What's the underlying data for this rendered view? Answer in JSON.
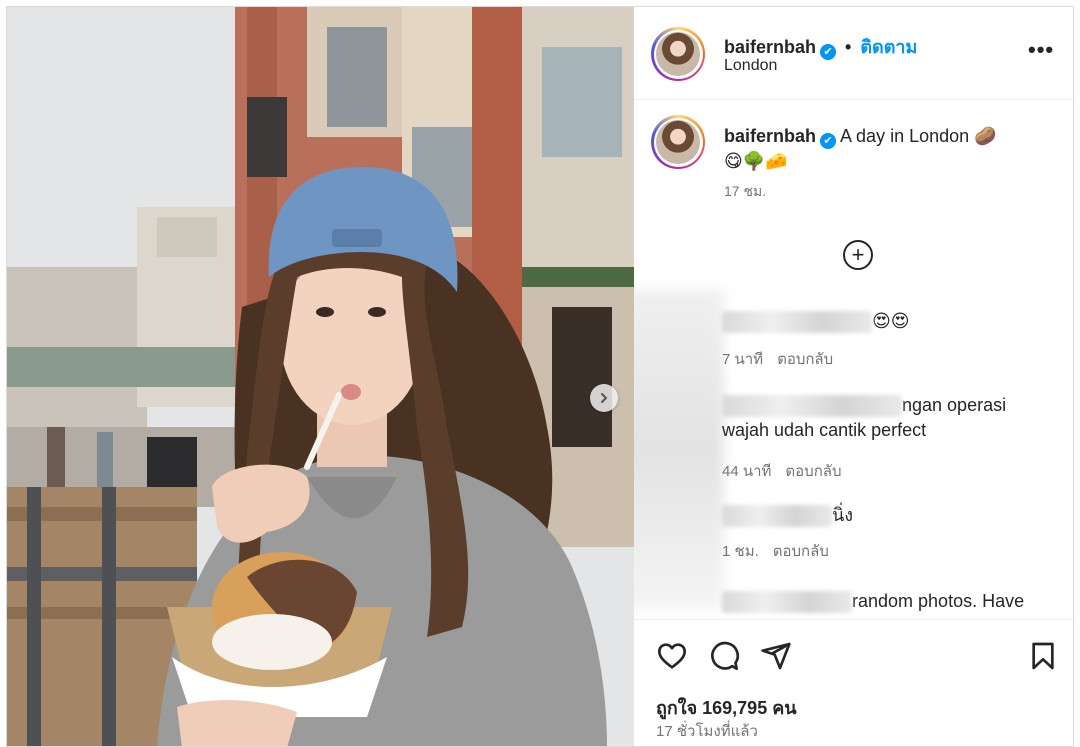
{
  "post": {
    "username": "baifernbah",
    "verified_mark": "✔",
    "separator": "•",
    "follow_label": "ติดตาม",
    "location": "London",
    "more_label": "•••"
  },
  "caption": {
    "username": "baifernbah",
    "text": "A day in London 🥔",
    "emoji_line": "😋🌳🧀",
    "time": "17 ชม."
  },
  "load_more_label": "+",
  "comments": [
    {
      "text_suffix": "😍😍",
      "time": "7 นาที",
      "reply": "ตอบกลับ"
    },
    {
      "text_suffix": "ngan operasi",
      "text_line2": "wajah udah cantik perfect",
      "time": "44 นาที",
      "reply": "ตอบกลับ"
    },
    {
      "text_suffix": "นิ่ง",
      "time": "1 ชม.",
      "reply": "ตอบกลับ"
    },
    {
      "text_suffix": "random photos. Have"
    }
  ],
  "actions": {
    "like_icon": "heart-icon",
    "comment_icon": "comment-icon",
    "share_icon": "share-icon",
    "save_icon": "bookmark-icon"
  },
  "likes_text": "ถูกใจ 169,795 คน",
  "posted_ago": "17 ชั่วโมงที่แล้ว",
  "colors": {
    "accent": "#0095f6",
    "muted": "#737373",
    "text": "#262626"
  }
}
